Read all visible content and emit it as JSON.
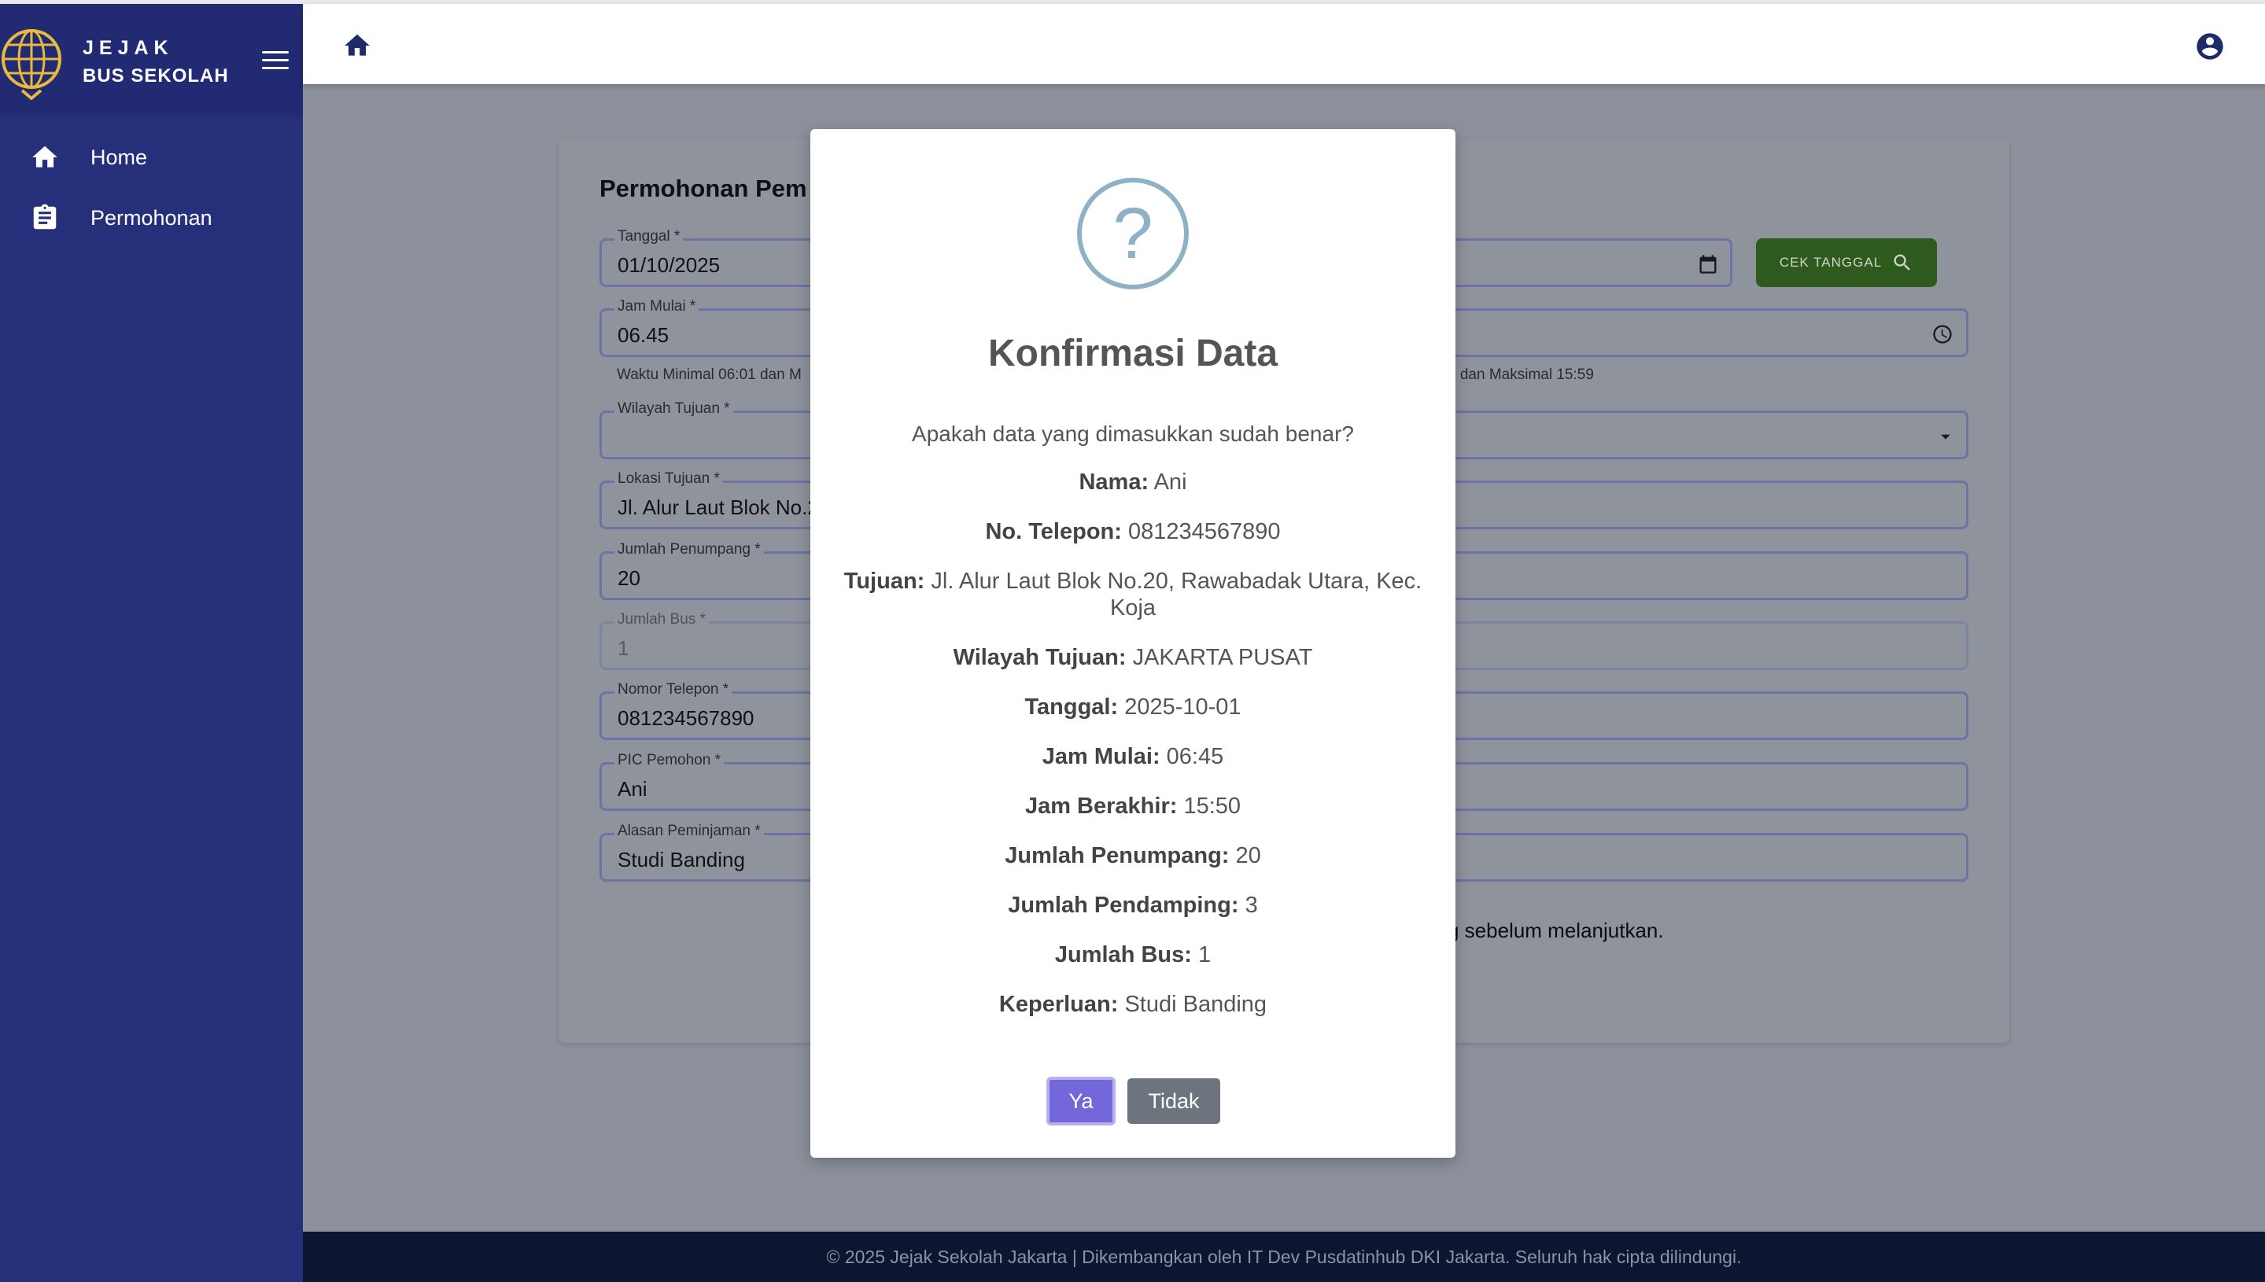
{
  "brand": {
    "line1": "JEJAK",
    "line2": "BUS SEKOLAH"
  },
  "sidebar": {
    "items": [
      {
        "label": "Home",
        "icon": "home-icon"
      },
      {
        "label": "Permohonan",
        "icon": "clipboard-icon"
      }
    ]
  },
  "header": {
    "home_icon": "home-icon",
    "user_icon": "account-circle-icon"
  },
  "form": {
    "title": "Permohonan Pem",
    "cek_button": "CEK TANGGAL",
    "fields": {
      "tanggal": {
        "label": "Tanggal *",
        "value": "01/10/2025"
      },
      "jam_mulai": {
        "label": "Jam Mulai *",
        "value": "06.45"
      },
      "jam_helper_left": "Waktu Minimal 06:01 dan M",
      "jam_helper_right": "1 dan Maksimal 15:59",
      "wilayah": {
        "label": "Wilayah Tujuan *",
        "value": ""
      },
      "lokasi": {
        "label": "Lokasi Tujuan *",
        "value": "Jl. Alur Laut Blok No.2"
      },
      "penumpang": {
        "label": "Jumlah Penumpang *",
        "value": "20"
      },
      "bus": {
        "label": "Jumlah Bus *",
        "value": "1"
      },
      "telepon": {
        "label": "Nomor Telepon *",
        "value": "081234567890"
      },
      "pic": {
        "label": "PIC Pemohon *",
        "value": "Ani"
      },
      "alasan": {
        "label": "Alasan Peminjaman *",
        "value": "Studi Banding"
      }
    },
    "notice": "g sebelum melanjutkan."
  },
  "footer": {
    "text": "© 2025 Jejak Sekolah Jakarta | Dikembangkan oleh IT Dev Pusdatinhub DKI Jakarta. Seluruh hak cipta dilindungi."
  },
  "modal": {
    "title": "Konfirmasi Data",
    "question": "Apakah data yang dimasukkan sudah benar?",
    "rows": [
      {
        "label": "Nama:",
        "value": "Ani"
      },
      {
        "label": "No. Telepon:",
        "value": "081234567890"
      },
      {
        "label": "Tujuan:",
        "value": "Jl. Alur Laut Blok No.20, Rawabadak Utara, Kec. Koja"
      },
      {
        "label": "Wilayah Tujuan:",
        "value": "JAKARTA PUSAT"
      },
      {
        "label": "Tanggal:",
        "value": "2025-10-01"
      },
      {
        "label": "Jam Mulai:",
        "value": "06:45"
      },
      {
        "label": "Jam Berakhir:",
        "value": "15:50"
      },
      {
        "label": "Jumlah Penumpang:",
        "value": "20"
      },
      {
        "label": "Jumlah Pendamping:",
        "value": "3"
      },
      {
        "label": "Jumlah Bus:",
        "value": "1"
      },
      {
        "label": "Keperluan:",
        "value": "Studi Banding"
      }
    ],
    "yes_label": "Ya",
    "no_label": "Tidak",
    "icon": "question-circle-icon"
  },
  "colors": {
    "sidebar": "#26307a",
    "footer": "#0c1630",
    "primary_button": "#7367d9",
    "secondary_button": "#6c757d",
    "cek_button": "#2f5a1e"
  }
}
